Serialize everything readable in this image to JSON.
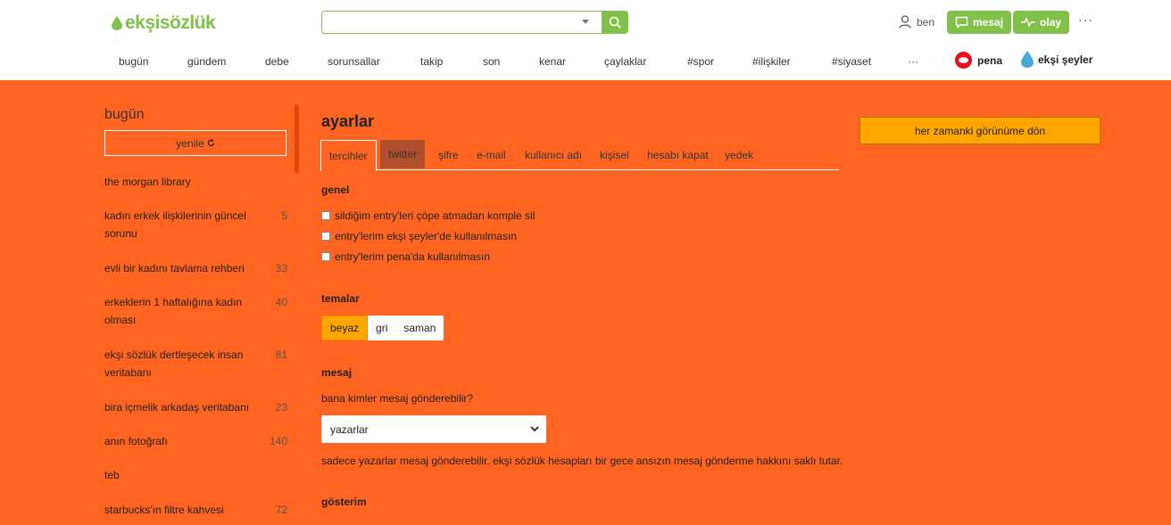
{
  "header": {
    "logo_text": "ekşisözlük",
    "search": {
      "value": "",
      "placeholder": ""
    },
    "user_label": "ben",
    "mesaj_label": "mesaj",
    "olay_label": "olay",
    "more_label": "···"
  },
  "nav": {
    "items": [
      "bugün",
      "gündem",
      "debe",
      "sorunsallar",
      "takip",
      "son",
      "kenar",
      "çaylaklar",
      "#spor",
      "#ilişkiler",
      "#siyaset",
      "···"
    ],
    "pena_label": "pena",
    "eksi_seyler_label": "ekşi şeyler"
  },
  "sidebar": {
    "title": "bugün",
    "refresh_label": "yenile",
    "topics": [
      {
        "title": "the morgan library",
        "count": ""
      },
      {
        "title": "kadın erkek ilişkilerinin güncel sorunu",
        "count": "5"
      },
      {
        "title": "evli bir kadını tavlama rehberi",
        "count": "33"
      },
      {
        "title": "erkeklerin 1 haftalığına kadın olması",
        "count": "40"
      },
      {
        "title": "ekşi sözlük dertleşecek insan veritabanı",
        "count": "81"
      },
      {
        "title": "bira içmelik arkadaş veritabanı",
        "count": "23"
      },
      {
        "title": "anın fotoğrafı",
        "count": "140"
      },
      {
        "title": "teb",
        "count": ""
      },
      {
        "title": "starbucks'ın filtre kahvesi",
        "count": "72"
      }
    ]
  },
  "main": {
    "title": "ayarlar",
    "tabs": [
      "tercihler",
      "twitter",
      "şifre",
      "e-mail",
      "kullanıcı adı",
      "kişisel",
      "hesabı kapat",
      "yedek"
    ],
    "genel": {
      "heading": "genel",
      "checkboxes": [
        "sildiğim entry'leri çöpe atmadan komple sil",
        "entry'lerim ekşi şeyler'de kullanılmasın",
        "entry'lerim pena'da kullanılmasın"
      ]
    },
    "temalar": {
      "heading": "temalar",
      "options": [
        "beyaz",
        "gri",
        "saman"
      ],
      "selected": "beyaz"
    },
    "mesaj": {
      "heading": "mesaj",
      "question": "bana kimler mesaj gönderebilir?",
      "selected_value": "yazarlar",
      "note": "sadece yazarlar mesaj gönderebilir. ekşi sözlük hesapları bir gece ansızın mesaj gönderme hakkını saklı tutar."
    },
    "gosterim": {
      "heading": "gösterim"
    }
  },
  "right": {
    "back_button_label": "her zamanki görünüme dön"
  },
  "colors": {
    "background": "#ff6520",
    "accent_green": "#81c14b",
    "button_yellow": "#ffa500"
  }
}
